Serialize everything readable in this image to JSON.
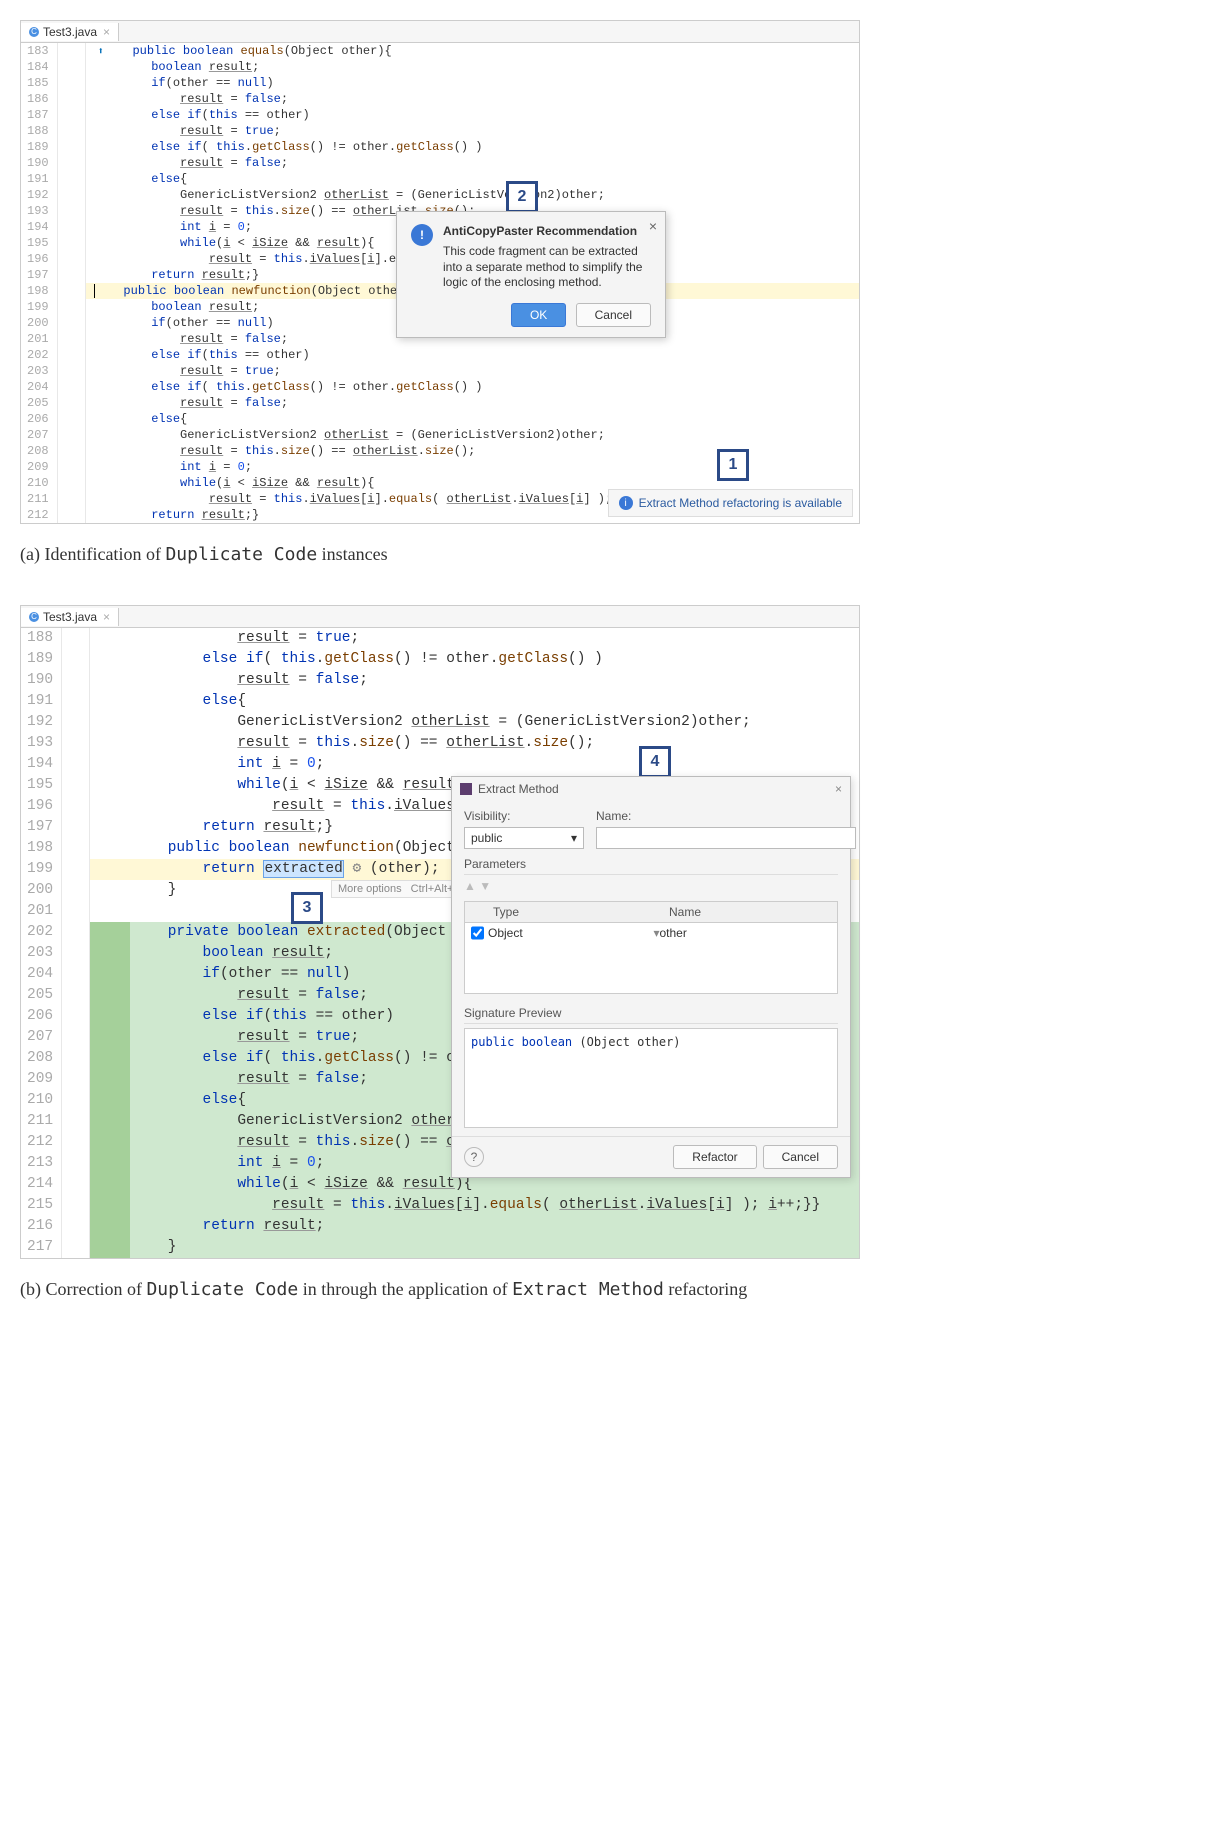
{
  "panelA": {
    "tab": {
      "filename": "Test3.java",
      "icon_letter": "C"
    },
    "linenumbers": [
      "183",
      "184",
      "185",
      "186",
      "187",
      "188",
      "189",
      "190",
      "191",
      "192",
      "193",
      "194",
      "195",
      "196",
      "197",
      "198",
      "199",
      "200",
      "201",
      "202",
      "203",
      "204",
      "205",
      "206",
      "207",
      "208",
      "209",
      "210",
      "211",
      "212"
    ],
    "code": [
      {
        "i": 0,
        "txt": "    public boolean equals(Object other){",
        "arrow": true
      },
      {
        "i": 1,
        "txt": "        boolean result;"
      },
      {
        "i": 2,
        "txt": "        if(other == null)"
      },
      {
        "i": 3,
        "txt": "            result = false;"
      },
      {
        "i": 4,
        "txt": "        else if(this == other)"
      },
      {
        "i": 5,
        "txt": "            result = true;"
      },
      {
        "i": 6,
        "txt": "        else if( this.getClass() != other.getClass() )"
      },
      {
        "i": 7,
        "txt": "            result = false;"
      },
      {
        "i": 8,
        "txt": "        else{"
      },
      {
        "i": 9,
        "txt": "            GenericListVersion2 otherList = (GenericListVersion2)other;"
      },
      {
        "i": 10,
        "txt": "            result = this.size() == otherList.size();"
      },
      {
        "i": 11,
        "txt": "            int i = 0;"
      },
      {
        "i": 12,
        "txt": "            while(i < iSize && result){"
      },
      {
        "i": 13,
        "txt": "                result = this.iValues[i].equ"
      },
      {
        "i": 14,
        "txt": "        return result;}"
      },
      {
        "i": 15,
        "txt": "    public boolean newfunction(Object other)",
        "hl": "y",
        "cursor": true
      },
      {
        "i": 16,
        "txt": "        boolean result;"
      },
      {
        "i": 17,
        "txt": "        if(other == null)"
      },
      {
        "i": 18,
        "txt": "            result = false;"
      },
      {
        "i": 19,
        "txt": "        else if(this == other)"
      },
      {
        "i": 20,
        "txt": "            result = true;"
      },
      {
        "i": 21,
        "txt": "        else if( this.getClass() != other.getClass() )"
      },
      {
        "i": 22,
        "txt": "            result = false;"
      },
      {
        "i": 23,
        "txt": "        else{"
      },
      {
        "i": 24,
        "txt": "            GenericListVersion2 otherList = (GenericListVersion2)other;"
      },
      {
        "i": 25,
        "txt": "            result = this.size() == otherList.size();"
      },
      {
        "i": 26,
        "txt": "            int i = 0;"
      },
      {
        "i": 27,
        "txt": "            while(i < iSize && result){"
      },
      {
        "i": 28,
        "txt": "                result = this.iValues[i].equals( otherList.iValues[i] ); i++;}}"
      },
      {
        "i": 29,
        "txt": "        return result;}"
      }
    ],
    "dialog2": {
      "title": "AntiCopyPaster Recommendation",
      "message": "This code fragment can be extracted into a separate method to simplify the logic of the enclosing method.",
      "ok": "OK",
      "cancel": "Cancel"
    },
    "notify1": {
      "text": "Extract Method refactoring is available"
    },
    "callout1": "1",
    "callout2": "2",
    "caption": "(a) Identification of Duplicate Code instances",
    "caption_mono": "Duplicate Code"
  },
  "panelB": {
    "tab": {
      "filename": "Test3.java",
      "icon_letter": "C"
    },
    "linenumbers": [
      "188",
      "189",
      "190",
      "191",
      "192",
      "193",
      "194",
      "195",
      "196",
      "197",
      "198",
      "199",
      "200",
      "201",
      "202",
      "203",
      "204",
      "205",
      "206",
      "207",
      "208",
      "209",
      "210",
      "211",
      "212",
      "213",
      "214",
      "215",
      "216",
      "217"
    ],
    "code": [
      {
        "i": 0,
        "txt": "                result = true;"
      },
      {
        "i": 1,
        "txt": "            else if( this.getClass() != other.getClass() )"
      },
      {
        "i": 2,
        "txt": "                result = false;"
      },
      {
        "i": 3,
        "txt": "            else{"
      },
      {
        "i": 4,
        "txt": "                GenericListVersion2 otherList = (GenericListVersion2)other;"
      },
      {
        "i": 5,
        "txt": "                result = this.size() == otherList.size();"
      },
      {
        "i": 6,
        "txt": "                int i = 0;"
      },
      {
        "i": 7,
        "txt": "                while(i < iSize && result){"
      },
      {
        "i": 8,
        "txt": "                    result = this.iValues[i]"
      },
      {
        "i": 9,
        "txt": "            return result;}"
      },
      {
        "i": 10,
        "txt": "        public boolean newfunction(Object oth"
      },
      {
        "i": 11,
        "txt": "            return extracted ⚙ (other);",
        "hl": "y",
        "sel": "extracted"
      },
      {
        "i": 12,
        "txt": "        }"
      },
      {
        "i": 13,
        "txt": ""
      },
      {
        "i": 14,
        "txt": "        private boolean extracted(Object othe",
        "hl": "g"
      },
      {
        "i": 15,
        "txt": "            boolean result;",
        "hl": "g"
      },
      {
        "i": 16,
        "txt": "            if(other == null)",
        "hl": "g"
      },
      {
        "i": 17,
        "txt": "                result = false;",
        "hl": "g"
      },
      {
        "i": 18,
        "txt": "            else if(this == other)",
        "hl": "g"
      },
      {
        "i": 19,
        "txt": "                result = true;",
        "hl": "g"
      },
      {
        "i": 20,
        "txt": "            else if( this.getClass() != other",
        "hl": "g"
      },
      {
        "i": 21,
        "txt": "                result = false;",
        "hl": "g"
      },
      {
        "i": 22,
        "txt": "            else{",
        "hl": "g"
      },
      {
        "i": 23,
        "txt": "                GenericListVersion2 otherList",
        "hl": "g"
      },
      {
        "i": 24,
        "txt": "                result = this.size() == otherList.size();",
        "hl": "g"
      },
      {
        "i": 25,
        "txt": "                int i = 0;",
        "hl": "g"
      },
      {
        "i": 26,
        "txt": "                while(i < iSize && result){",
        "hl": "g"
      },
      {
        "i": 27,
        "txt": "                    result = this.iValues[i].equals( otherList.iValues[i] ); i++;}}",
        "hl": "g"
      },
      {
        "i": 28,
        "txt": "            return result;",
        "hl": "g"
      },
      {
        "i": 29,
        "txt": "        }",
        "hl": "g"
      }
    ],
    "tooltip": {
      "label": "More options",
      "shortcut": "Ctrl+Alt+M"
    },
    "callout3": "3",
    "callout4": "4",
    "em_dialog": {
      "title": "Extract Method",
      "vis_label": "Visibility:",
      "name_label": "Name:",
      "visibility": "public",
      "params_label": "Parameters",
      "type_header": "Type",
      "name_header": "Name",
      "param_type": "Object",
      "param_name": "other",
      "sig_label": "Signature Preview",
      "signature": "public boolean (Object other)",
      "refactor": "Refactor",
      "cancel": "Cancel",
      "help": "?"
    },
    "caption": "(b) Correction of Duplicate Code in through the application of Extract Method refactoring",
    "caption_mono1": "Duplicate Code",
    "caption_mono2": "Extract Method"
  }
}
